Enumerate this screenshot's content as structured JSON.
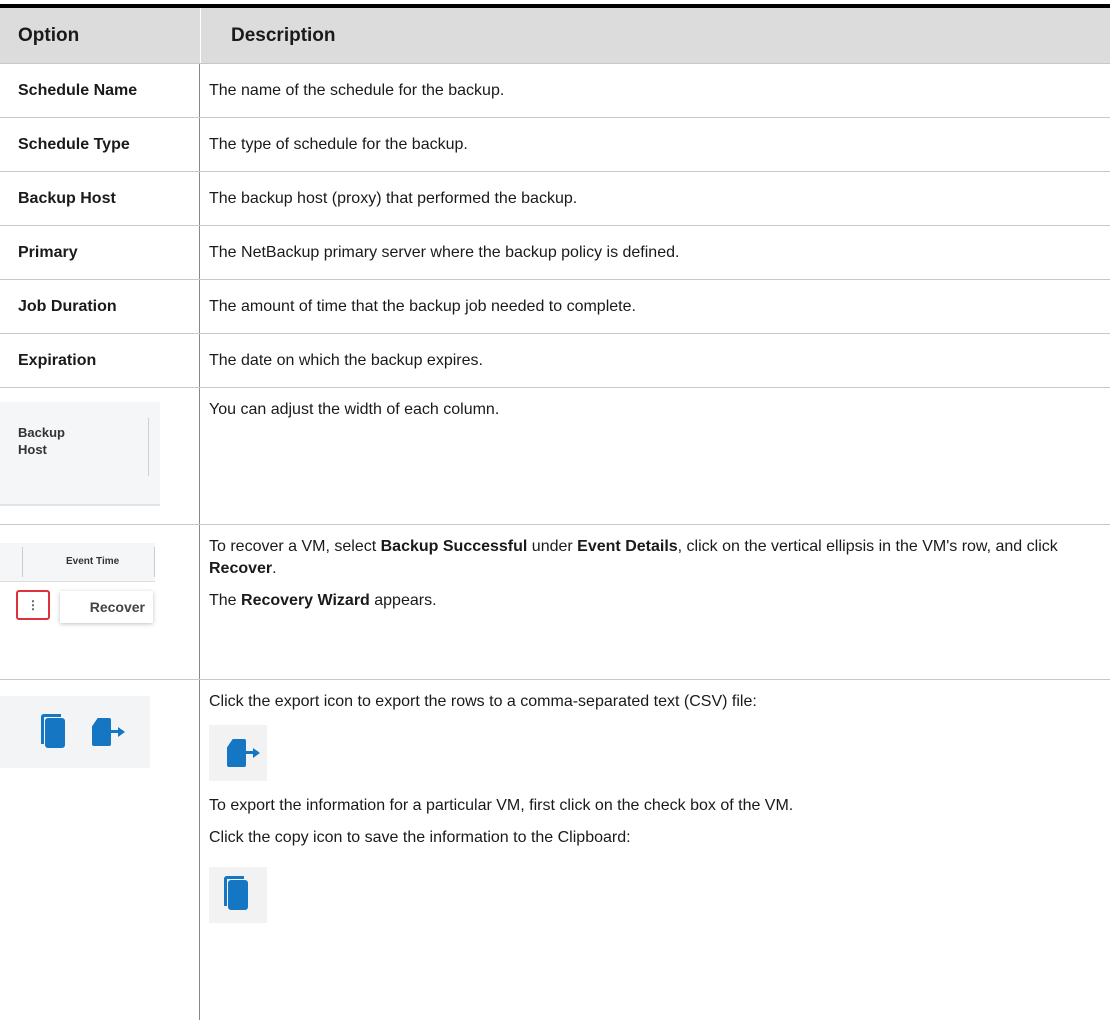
{
  "header": {
    "option": "Option",
    "description": "Description"
  },
  "rows": [
    {
      "option": "Schedule Name",
      "description": "The name of the schedule for the backup."
    },
    {
      "option": "Schedule Type",
      "description": "The type of schedule for the backup."
    },
    {
      "option": "Backup Host",
      "description": "The backup host (proxy) that performed the backup."
    },
    {
      "option": "Primary",
      "description": "The NetBackup primary server where the backup policy is defined."
    },
    {
      "option": "Job Duration",
      "description": "The amount of time that the backup job needed to complete."
    },
    {
      "option": "Expiration",
      "description": "The date on which the backup expires."
    }
  ],
  "column_width": {
    "thumb_label_1": "Backup",
    "thumb_label_2": "Host",
    "description": "You can adjust the width of each column."
  },
  "recover": {
    "thumb_header": "Event Time",
    "thumb_dots": "⋮",
    "thumb_menu": "Recover",
    "p1_a": "To recover a VM, select ",
    "p1_b": "Backup Successful",
    "p1_c": " under ",
    "p1_d": "Event Details",
    "p1_e": ", click on the vertical ellipsis in the VM's row, and click ",
    "p1_f": "Recover",
    "p1_g": ".",
    "p2_a": "The ",
    "p2_b": "Recovery Wizard",
    "p2_c": " appears."
  },
  "export": {
    "p1": "Click the export icon to export the rows to a comma-separated text (CSV) file:",
    "p2": "To export the information for a particular VM, first click on the check box of the VM.",
    "p3": "Click the copy icon to save the information to the Clipboard:",
    "icons": [
      "copy-icon",
      "export-icon"
    ],
    "icon_color": "#1576c4"
  }
}
